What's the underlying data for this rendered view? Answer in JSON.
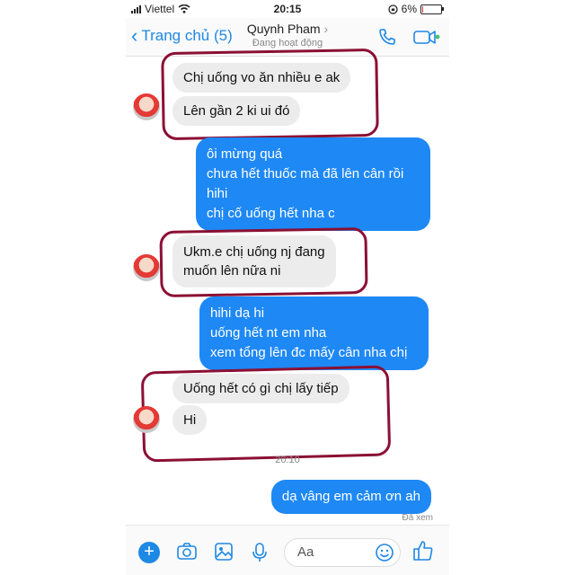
{
  "status_bar": {
    "carrier": "Viettel",
    "time": "20:15",
    "battery": "6%",
    "battery_level": 0.06
  },
  "header": {
    "back_label": "Trang chủ (5)",
    "contact_name": "Quynh Pham",
    "contact_status": "Đang hoạt động"
  },
  "messages": {
    "in1": "Chị uống vo ăn nhiều e ak",
    "in2": "Lên gần 2 ki ui đó",
    "out1": [
      "ôi mừng quá",
      "chưa hết thuốc mà đã lên cân rồi",
      "hihi",
      "chị cố uống hết nha c"
    ],
    "in3": [
      "Ukm.e  chị uống nj đang",
      "muốn lên nữa ni"
    ],
    "out2": [
      "hihi dạ hi",
      "uống hết nt em nha",
      "xem tổng lên đc mấy cân nha chị"
    ],
    "in4": "Uống hết có gì chị lấy tiếp",
    "in5": "Hi",
    "time": "20:10",
    "out3": "dạ vâng em cảm ơn ah",
    "seen": "Đã xem"
  },
  "composer": {
    "placeholder": "Aa"
  },
  "colors": {
    "accent": "#1e88f5",
    "circle": "#8b1034",
    "incoming": "#ececec"
  }
}
